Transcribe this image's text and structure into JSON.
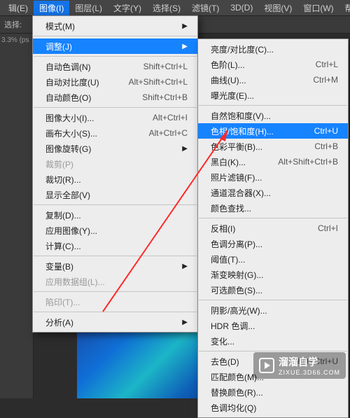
{
  "menubar": {
    "items": [
      "辑(E)",
      "图像(I)",
      "图层(L)",
      "文字(Y)",
      "选择(S)",
      "滤镜(T)",
      "3D(D)",
      "视图(V)",
      "窗口(W)",
      "帮"
    ],
    "active_index": 1
  },
  "toolbar": {
    "label": "选择:"
  },
  "left_panel": {
    "zoom": "3.3% (ps"
  },
  "main_menu": {
    "items": [
      {
        "label": "模式(M)",
        "arrow": true
      },
      {
        "sep": true
      },
      {
        "label": "调整(J)",
        "arrow": true,
        "highlight": true
      },
      {
        "sep": true
      },
      {
        "label": "自动色调(N)",
        "shortcut": "Shift+Ctrl+L"
      },
      {
        "label": "自动对比度(U)",
        "shortcut": "Alt+Shift+Ctrl+L"
      },
      {
        "label": "自动颜色(O)",
        "shortcut": "Shift+Ctrl+B"
      },
      {
        "sep": true
      },
      {
        "label": "图像大小(I)...",
        "shortcut": "Alt+Ctrl+I"
      },
      {
        "label": "画布大小(S)...",
        "shortcut": "Alt+Ctrl+C"
      },
      {
        "label": "图像旋转(G)",
        "arrow": true
      },
      {
        "label": "裁剪(P)",
        "disabled": true
      },
      {
        "label": "裁切(R)..."
      },
      {
        "label": "显示全部(V)"
      },
      {
        "sep": true
      },
      {
        "label": "复制(D)..."
      },
      {
        "label": "应用图像(Y)..."
      },
      {
        "label": "计算(C)..."
      },
      {
        "sep": true
      },
      {
        "label": "变量(B)",
        "arrow": true
      },
      {
        "label": "应用数据组(L)...",
        "disabled": true
      },
      {
        "sep": true
      },
      {
        "label": "陷印(T)...",
        "disabled": true
      },
      {
        "sep": true
      },
      {
        "label": "分析(A)",
        "arrow": true
      }
    ]
  },
  "sub_menu": {
    "items": [
      {
        "label": "亮度/对比度(C)..."
      },
      {
        "label": "色阶(L)...",
        "shortcut": "Ctrl+L"
      },
      {
        "label": "曲线(U)...",
        "shortcut": "Ctrl+M"
      },
      {
        "label": "曝光度(E)..."
      },
      {
        "sep": true
      },
      {
        "label": "自然饱和度(V)..."
      },
      {
        "label": "色相/饱和度(H)...",
        "shortcut": "Ctrl+U",
        "highlight": true
      },
      {
        "label": "色彩平衡(B)...",
        "shortcut": "Ctrl+B"
      },
      {
        "label": "黑白(K)...",
        "shortcut": "Alt+Shift+Ctrl+B"
      },
      {
        "label": "照片滤镜(F)..."
      },
      {
        "label": "通道混合器(X)..."
      },
      {
        "label": "颜色查找..."
      },
      {
        "sep": true
      },
      {
        "label": "反相(I)",
        "shortcut": "Ctrl+I"
      },
      {
        "label": "色调分离(P)..."
      },
      {
        "label": "阈值(T)..."
      },
      {
        "label": "渐变映射(G)..."
      },
      {
        "label": "可选颜色(S)..."
      },
      {
        "sep": true
      },
      {
        "label": "阴影/高光(W)..."
      },
      {
        "label": "HDR 色调..."
      },
      {
        "label": "变化..."
      },
      {
        "sep": true
      },
      {
        "label": "去色(D)",
        "shortcut": "Shift+Ctrl+U"
      },
      {
        "label": "匹配颜色(M)..."
      },
      {
        "label": "替换颜色(R)..."
      },
      {
        "label": "色调均化(Q)"
      }
    ]
  },
  "watermark": {
    "title": "溜溜自学",
    "sub": "ZIXUE.3D66.COM"
  }
}
